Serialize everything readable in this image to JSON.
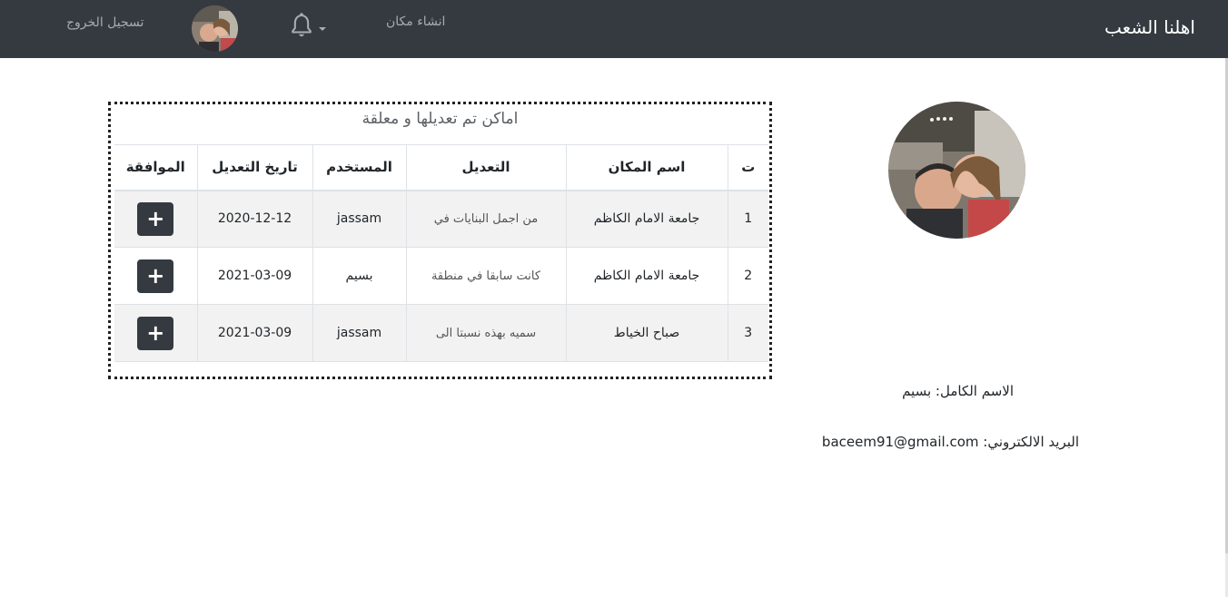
{
  "navbar": {
    "brand": "اهلنا الشعب",
    "create_place": "انشاء مكان",
    "logout": "تسجيل الخروج",
    "bell_icon": "bell-icon",
    "caret_icon": "caret-down-icon"
  },
  "profile": {
    "full_name_line": "الاسم الكامل: بسيم",
    "email_line": "البريد الالكتروني: baceem91@gmail.com"
  },
  "panel": {
    "title": "اماكن تم تعديلها و معلقة",
    "columns": [
      "ت",
      "اسم المكان",
      "التعديل",
      "المستخدم",
      "تاريخ التعديل",
      "الموافقة"
    ],
    "rows": [
      {
        "num": "1",
        "place": "جامعة الامام الكاظم",
        "edit": "من اجمل البنايات في",
        "user": "jassam",
        "date": "2020-12-12",
        "approve": "+"
      },
      {
        "num": "2",
        "place": "جامعة الامام الكاظم",
        "edit": "كانت سابقا في منطقة",
        "user": "بسيم",
        "date": "2021-03-09",
        "approve": "+"
      },
      {
        "num": "3",
        "place": "صباح الخياط",
        "edit": "سميه بهذه نسبتا الى",
        "user": "jassam",
        "date": "2021-03-09",
        "approve": "+"
      }
    ]
  },
  "colors": {
    "navbar_bg": "#343a40",
    "button_bg": "#343a40",
    "stripe_bg": "#f2f2f2"
  }
}
